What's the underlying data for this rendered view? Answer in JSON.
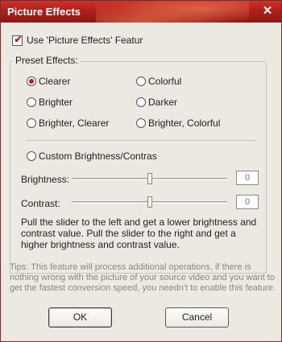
{
  "window": {
    "title": "Picture Effects"
  },
  "options": {
    "use_effects_label": "Use 'Picture Effects' Featur",
    "use_effects_checked": true,
    "preset_group_label": "Preset Effects:",
    "presets": [
      {
        "label": "Clearer",
        "selected": true
      },
      {
        "label": "Colorful",
        "selected": false
      },
      {
        "label": "Brighter",
        "selected": false
      },
      {
        "label": "Darker",
        "selected": false
      },
      {
        "label": "Brighter, Clearer",
        "selected": false
      },
      {
        "label": "Brighter, Colorful",
        "selected": false
      }
    ],
    "custom_label": "Custom Brightness/Contras",
    "custom_selected": false
  },
  "sliders": {
    "brightness": {
      "label": "Brightness:",
      "value": "0"
    },
    "contrast": {
      "label": "Contrast:",
      "value": "0"
    }
  },
  "description": "Pull the slider to the left and get a lower brightness and contrast value. Pull the slider to the right and get a higher brightness and contrast value.",
  "tips": "Tips: This feature will process additional operations, if there is nothing wrong with the picture of your source video and you want to get the fastest conversion speed, you needn't to enable this feature.",
  "buttons": {
    "ok": "OK",
    "cancel": "Cancel"
  },
  "colors": {
    "title_bar": "#b0201b",
    "accent": "#c51a14"
  }
}
